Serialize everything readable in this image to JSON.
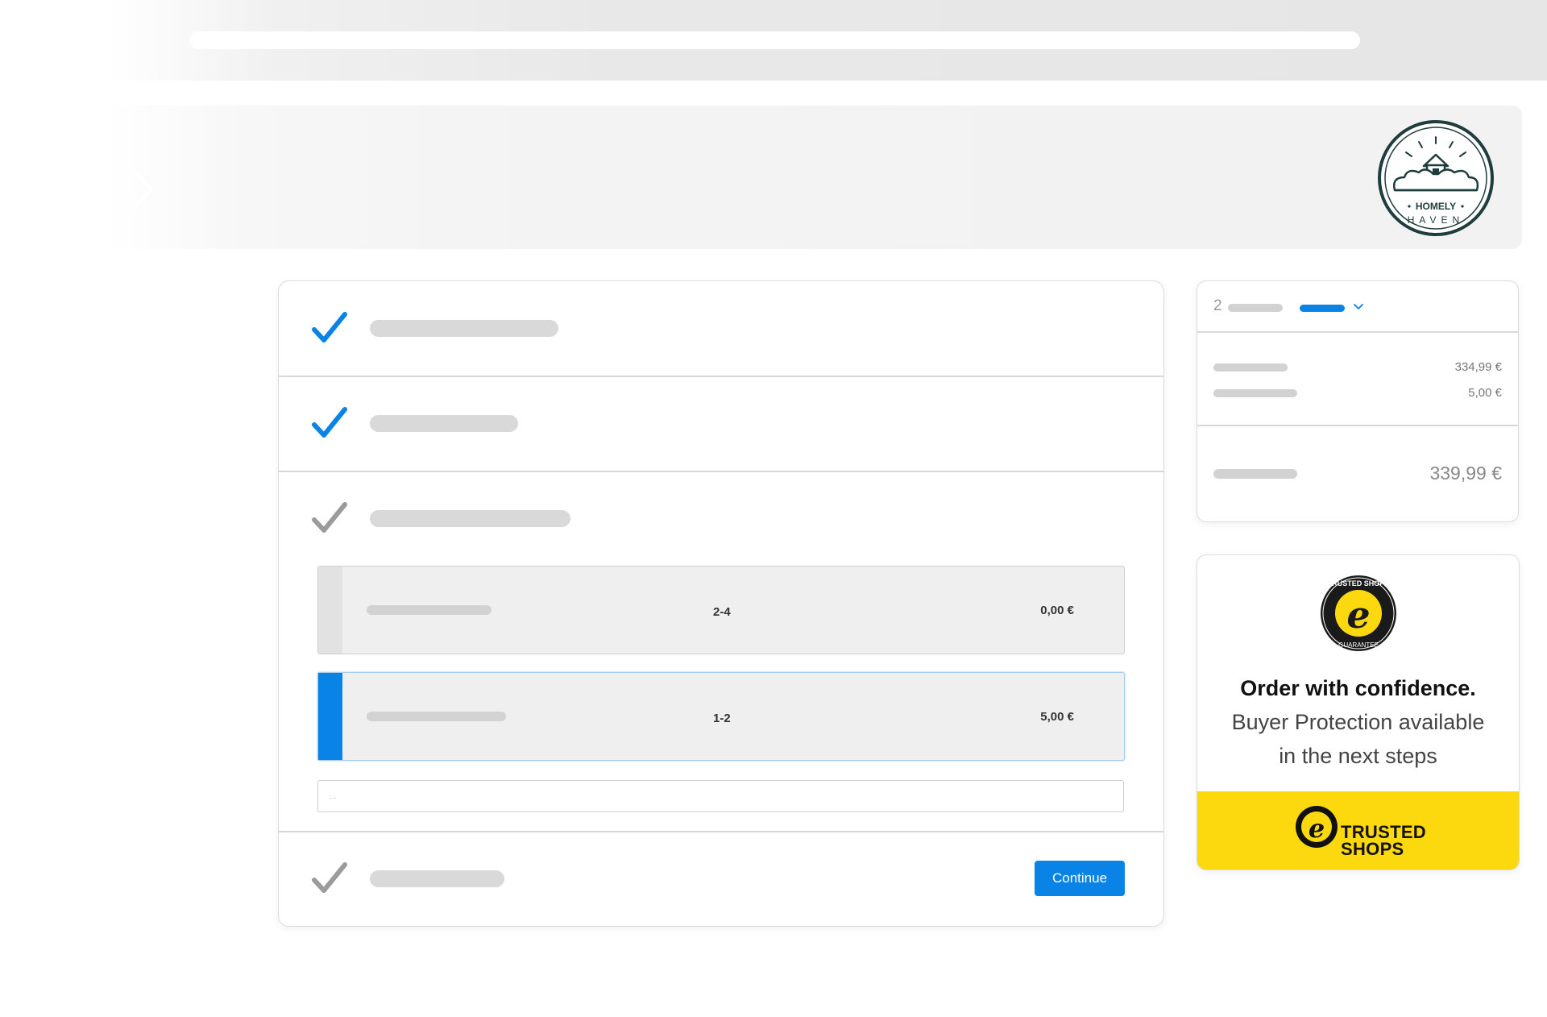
{
  "checkout": {
    "shipping_options": [
      {
        "range": "2-4",
        "price": "0,00 €",
        "selected": false
      },
      {
        "range": "1-2",
        "price": "5,00 €",
        "selected": true
      }
    ],
    "note_placeholder": "...",
    "continue_label": "Continue"
  },
  "summary": {
    "item_count": "2",
    "lines": [
      {
        "value": "334,99 €"
      },
      {
        "value": "5,00 €"
      }
    ],
    "total": "339,99 €"
  },
  "trusted": {
    "title": "Order with confidence.",
    "subtitle_line1": "Buyer Protection available",
    "subtitle_line2": "in the next steps",
    "brand_line1": "TRUSTED",
    "brand_line2": "SHOPS"
  },
  "colors": {
    "accent": "#0a83e6",
    "check_done": "#0a83e6",
    "check_pending": "#9b9b9b",
    "trusted_yellow": "#fcd90f"
  },
  "icons": {
    "done": "checkmark-icon",
    "pending": "checkmark-icon",
    "dropdown": "chevron-down-icon"
  }
}
